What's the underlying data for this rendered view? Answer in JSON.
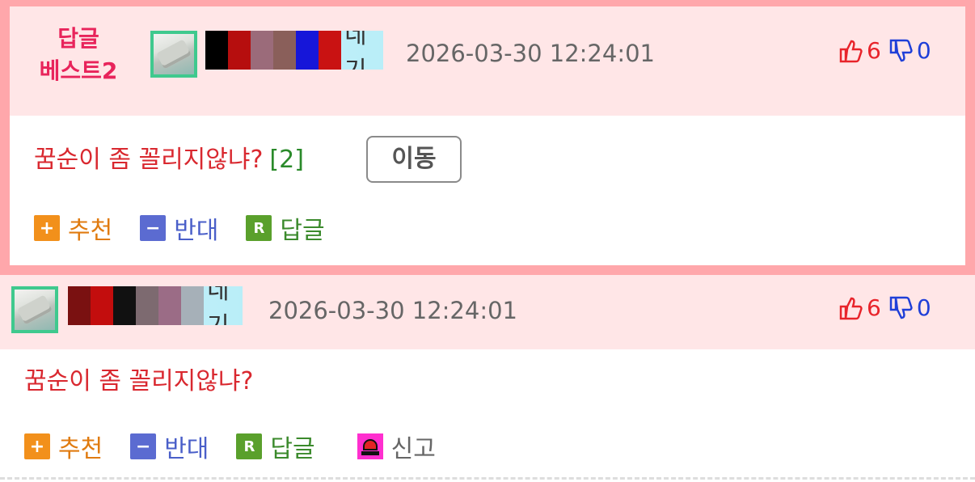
{
  "best_reply": {
    "badge_line1": "답글",
    "badge_line2": "베스트2",
    "nickname_tail": "네기",
    "date": "2026-03-30 12:24:01",
    "likes": "6",
    "dislikes": "0",
    "text": "꿈순이 좀 꼴리지않냐?",
    "reply_count": "[2]",
    "move_label": "이동",
    "actions": {
      "recommend": "추천",
      "oppose": "반대",
      "reply": "답글"
    }
  },
  "reply": {
    "nickname_tail": "네기",
    "date": "2026-03-30 12:24:01",
    "likes": "6",
    "dislikes": "0",
    "text": "꿈순이 좀 꼴리지않냐?",
    "actions": {
      "recommend": "추천",
      "oppose": "반대",
      "reply": "답글",
      "report": "신고"
    }
  },
  "icons": {
    "thumbs_up": "thumbs-up-icon",
    "thumbs_down": "thumbs-down-icon",
    "plus": "plus-icon",
    "minus": "minus-icon",
    "reply": "reply-r-icon",
    "report": "siren-icon"
  },
  "colors": {
    "best_border": "#ffa7ab",
    "header_bg": "#ffe6e7",
    "badge": "#e8245b",
    "like": "#e8242b",
    "dislike": "#1f3fd8",
    "comment_text": "#d9282f"
  }
}
